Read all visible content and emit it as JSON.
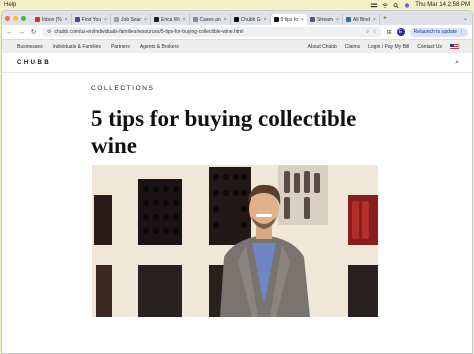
{
  "menubar": {
    "app": "Help",
    "datetime": "Thu Mar 14  2:58 PM"
  },
  "tabs": [
    {
      "label": "Inbox (%",
      "color": "#d93025"
    },
    {
      "label": "Find You",
      "color": "#5b3bb5"
    },
    {
      "label": "Job Sear",
      "color": "#9aa0a6"
    },
    {
      "label": "Erica Wi",
      "color": "#1f1f1f"
    },
    {
      "label": "Cases an",
      "color": "#7d8ea3"
    },
    {
      "label": "Chubb G",
      "color": "#111111"
    },
    {
      "label": "5 tips fo",
      "color": "#111111",
      "active": true
    },
    {
      "label": "Stream",
      "color": "#4a5d75"
    },
    {
      "label": "All Bind",
      "color": "#2d6fa3"
    }
  ],
  "toolbar": {
    "url": "chubb.com/us-en/individuals-families/resources/5-tips-for-buying-collectible-wine.html",
    "profile_initial": "E",
    "relaunch_label": "Relaunch to update"
  },
  "site": {
    "topnav_left": [
      "Businesses",
      "Individuals & Families",
      "Partners",
      "Agents & Brokers"
    ],
    "topnav_right": [
      "About Chubb",
      "Claims",
      "Login / Pay My Bill",
      "Contact Us"
    ],
    "logo": "CHUBB"
  },
  "article": {
    "eyebrow": "COLLECTIONS",
    "title": "5 tips for buying collectible wine"
  },
  "colors": {
    "accent": "#1a3f8c",
    "menubar_bg": "#f5f1c7",
    "tabstrip_bg": "#dfe3e8"
  }
}
